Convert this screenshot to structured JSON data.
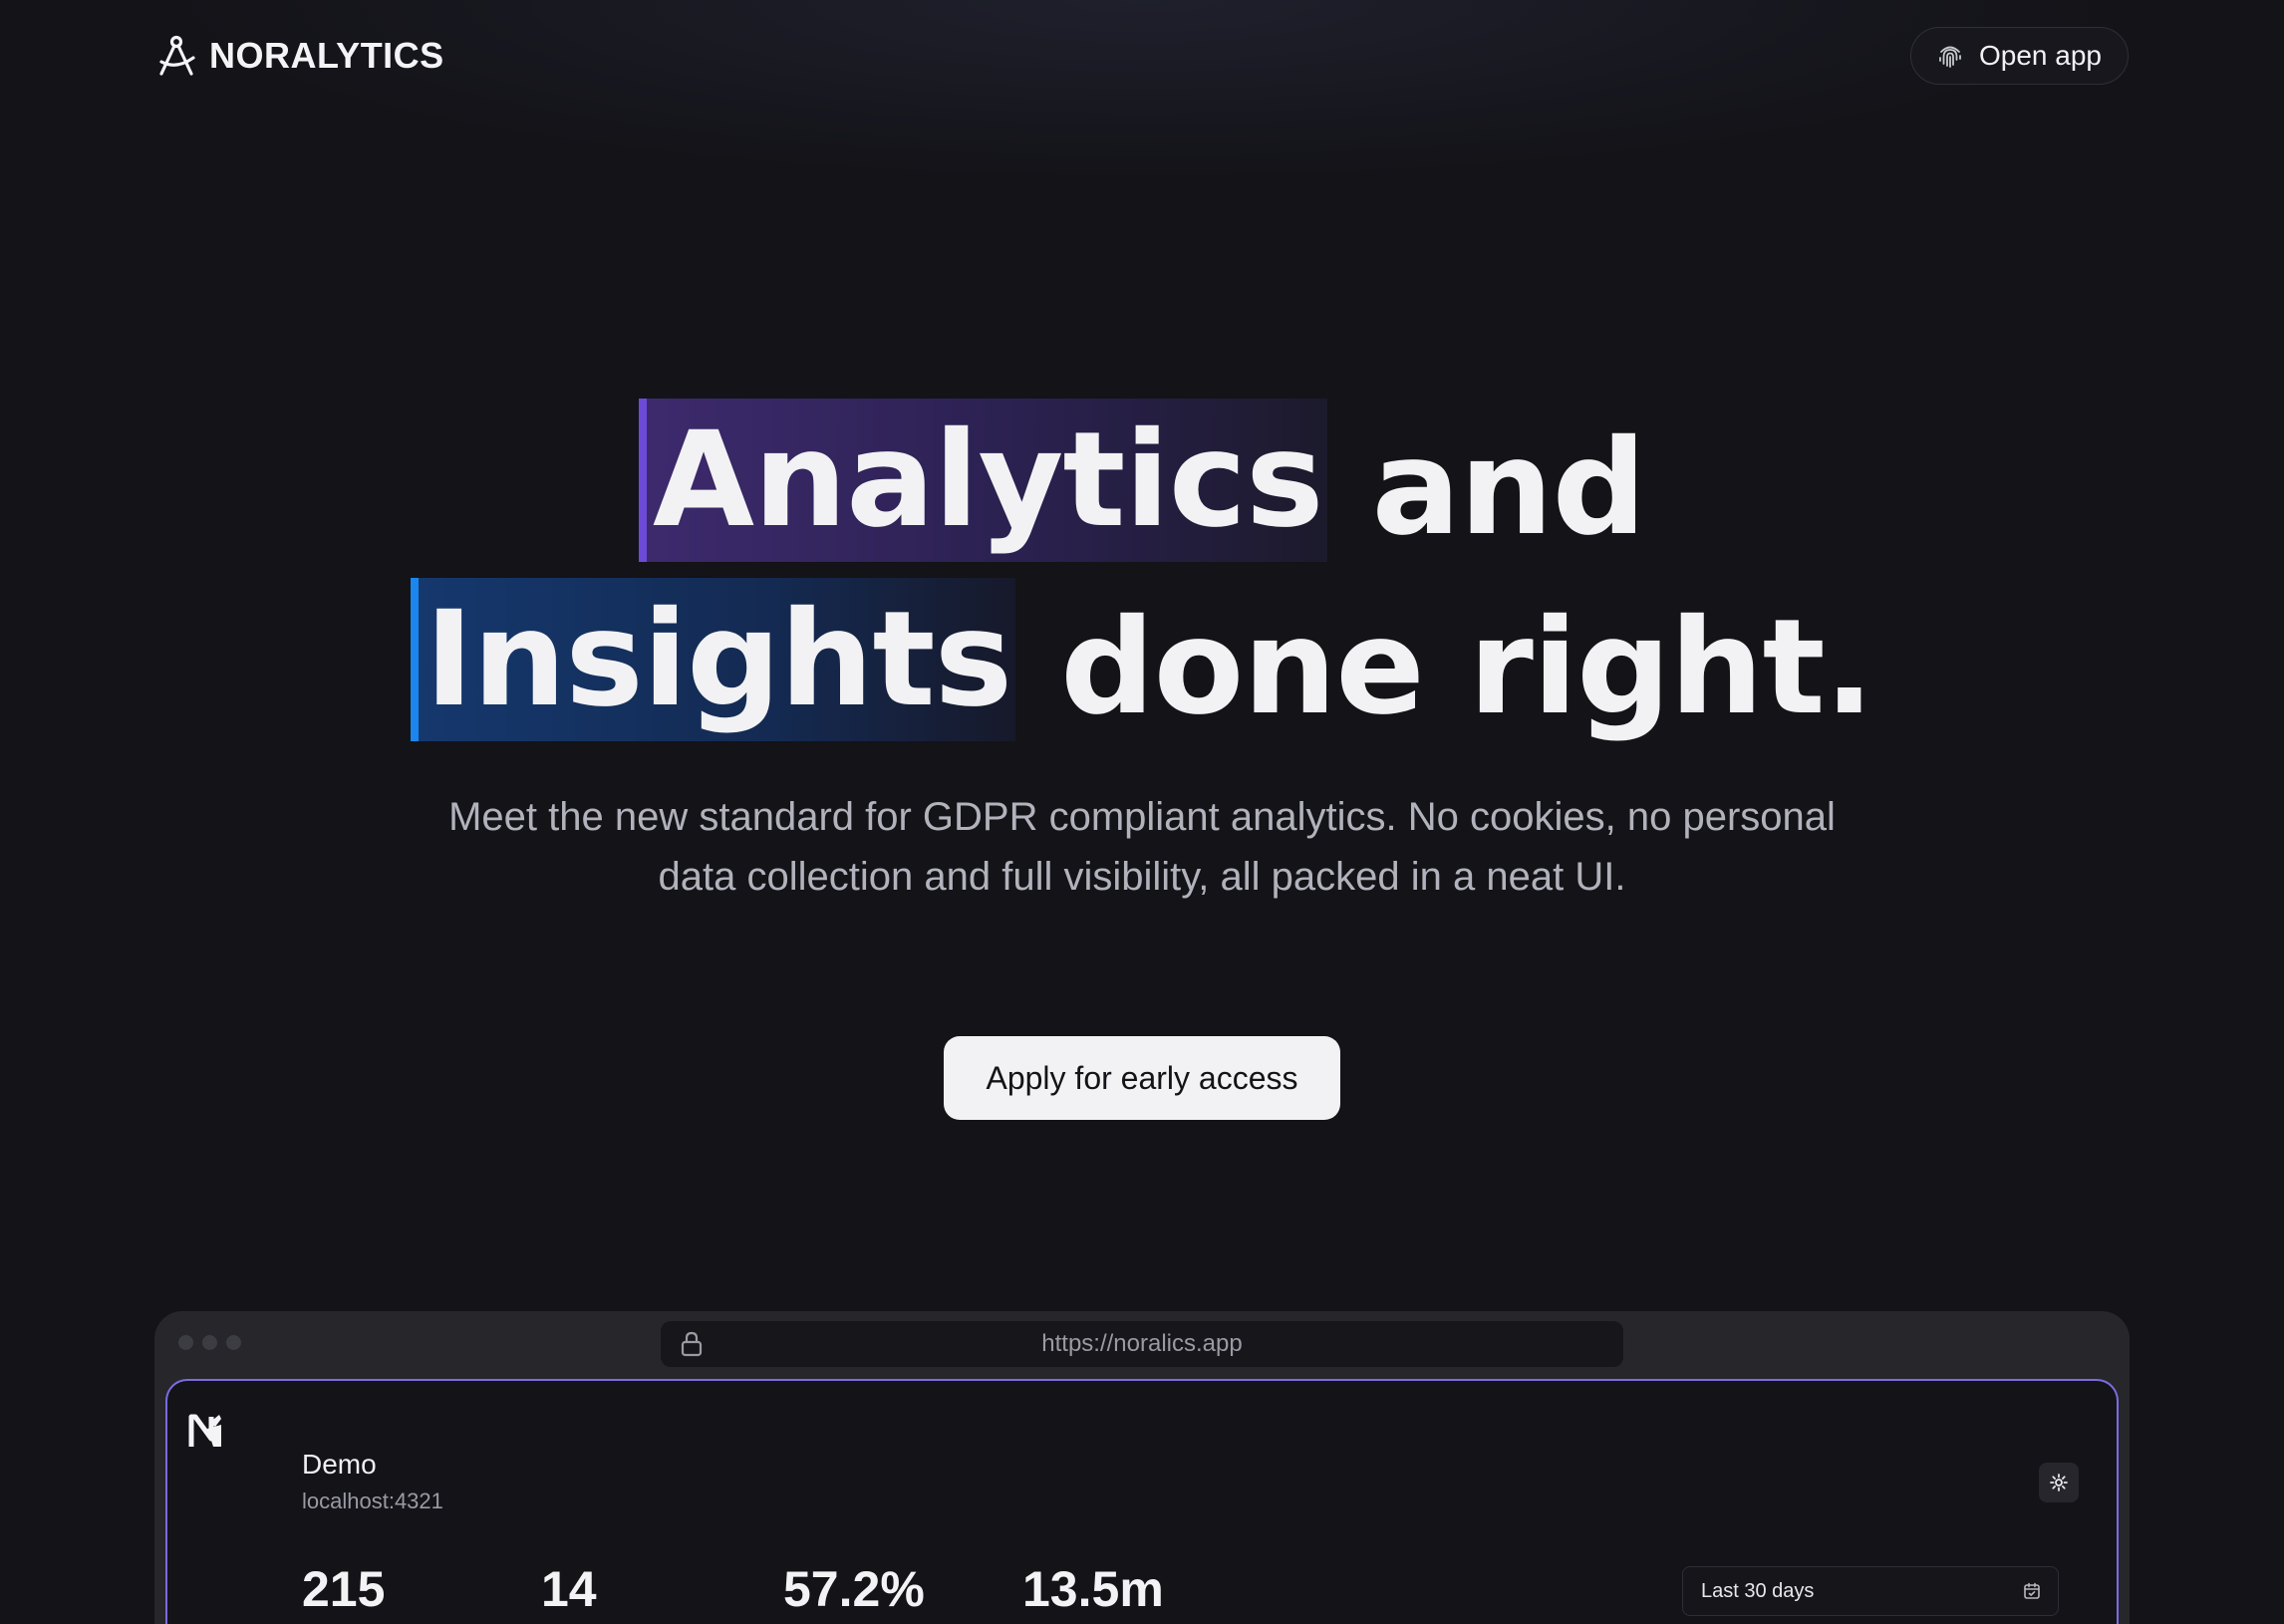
{
  "header": {
    "brand_name": "NORALYTICS",
    "open_app_label": "Open app"
  },
  "hero": {
    "line1": {
      "highlight": "Analytics",
      "rest": " and"
    },
    "line2": {
      "highlight": "Insights",
      "middle": " done ",
      "bold": "right."
    },
    "subtitle_line1": "Meet the new standard for GDPR compliant analytics. No cookies, no personal",
    "subtitle_line2": "data collection and full visibility, all packed in a neat UI.",
    "cta_label": "Apply for early access"
  },
  "browser": {
    "url": "https://noralics.app"
  },
  "app": {
    "site_name": "Demo",
    "site_host": "localhost:4321",
    "stats": [
      "215",
      "14",
      "57.2%",
      "13.5m"
    ],
    "date_range": "Last 30 days"
  },
  "colors": {
    "background": "#131318",
    "highlight_purple": "#6d4ad8",
    "highlight_blue": "#1a86ee",
    "app_border": "#7a6ce0",
    "cta_background": "#f2f2f4"
  },
  "icons": {
    "brand": "compass-icon",
    "open_app": "fingerprint-icon",
    "url_lock": "lock-icon",
    "app_settings": "gear-icon",
    "date_range": "calendar-icon"
  }
}
